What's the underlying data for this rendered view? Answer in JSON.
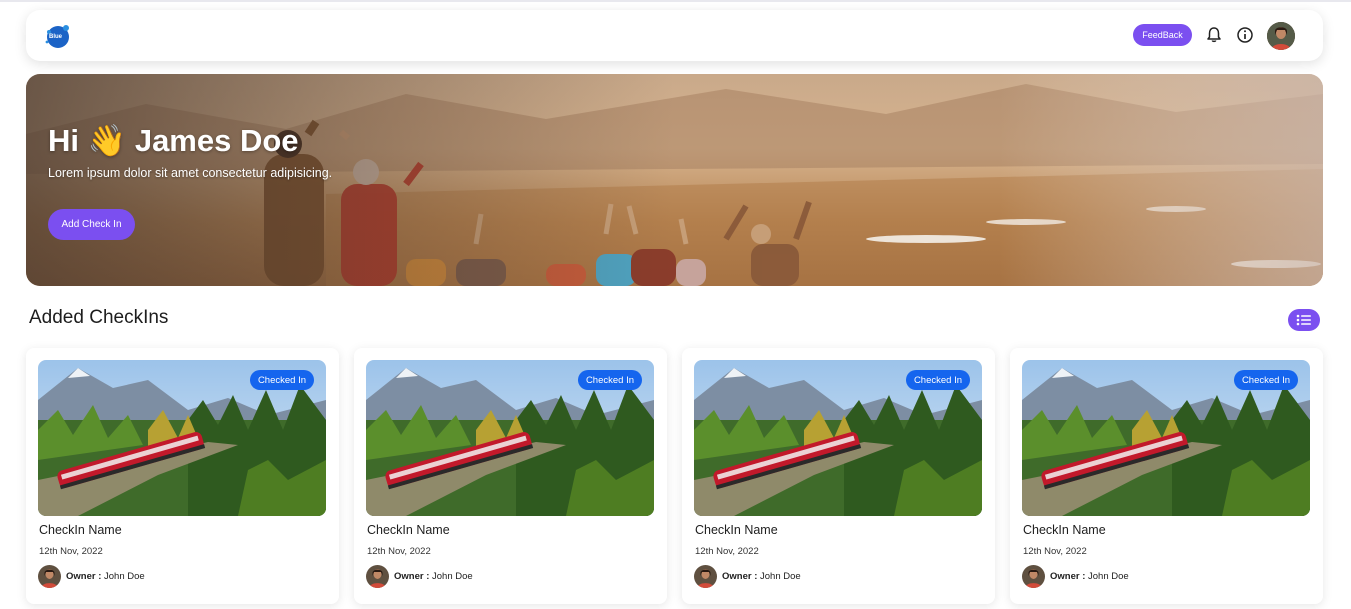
{
  "navbar": {
    "logo_text": "Blue",
    "feedback_label": "FeedBack",
    "icons": [
      "bell-icon",
      "info-icon",
      "user-avatar"
    ]
  },
  "hero": {
    "greeting": "Hi 👋 James Doe",
    "subtitle": "Lorem ipsum dolor sit amet consectetur adipisicing.",
    "add_button": "Add Check In"
  },
  "section": {
    "title": "Added CheckIns",
    "view_toggle_icon": "list-icon"
  },
  "cards": [
    {
      "badge": "Checked In",
      "name": "CheckIn Name",
      "date": "12th Nov, 2022",
      "owner_label": "Owner :",
      "owner_name": "John Doe"
    },
    {
      "badge": "Checked In",
      "name": "CheckIn Name",
      "date": "12th Nov, 2022",
      "owner_label": "Owner :",
      "owner_name": "John Doe"
    },
    {
      "badge": "Checked In",
      "name": "CheckIn Name",
      "date": "12th Nov, 2022",
      "owner_label": "Owner :",
      "owner_name": "John Doe"
    },
    {
      "badge": "Checked In",
      "name": "CheckIn Name",
      "date": "12th Nov, 2022",
      "owner_label": "Owner :",
      "owner_name": "John Doe"
    }
  ],
  "colors": {
    "accent": "#7b4ff0",
    "badge": "#1565ee"
  }
}
